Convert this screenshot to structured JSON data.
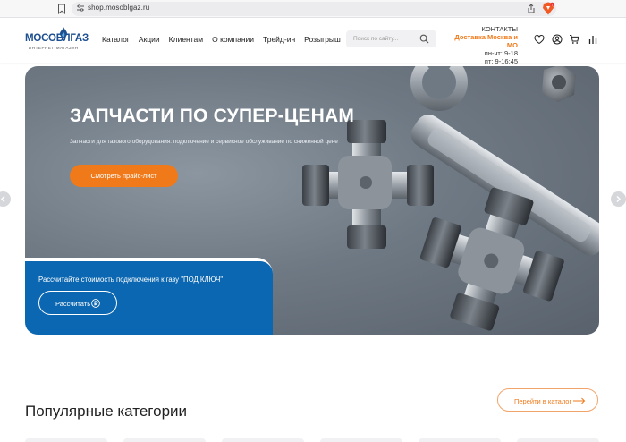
{
  "browser": {
    "url": "shop.mosoblgaz.ru",
    "icons": [
      "bookmark-icon",
      "tune-icon",
      "share-icon",
      "brave-shield-icon"
    ]
  },
  "header": {
    "logo": {
      "name": "МОСОБЛГАЗ",
      "subtitle": "ИНТЕРНЕТ-МАГАЗИН",
      "brand_color": "#1d4f91"
    },
    "nav": [
      "Каталог",
      "Акции",
      "Клиентам",
      "О компании",
      "Трейд-ин",
      "Розыгрыш"
    ],
    "search": {
      "placeholder": "Поиск по сайту..."
    },
    "contacts": {
      "title": "КОНТАКТЫ",
      "delivery": "Доставка Москва и МО",
      "hours_weekdays": "пн-чт: 9-18",
      "hours_friday": "пт: 9-16:45"
    },
    "icons": [
      "heart-icon",
      "user-icon",
      "cart-icon",
      "compare-icon"
    ]
  },
  "hero": {
    "title": "ЗАПЧАСТИ ПО СУПЕР-ЦЕНАМ",
    "subtitle": "Запчасти для газового оборудования: подключение и сервисное обслуживание по сниженной цене",
    "cta": "Смотреть прайс-лист",
    "accent": "#f07a1a",
    "calc": {
      "text": "Рассчитайте стоимость подключения к газу \"ПОД КЛЮЧ\"",
      "button": "Рассчитать",
      "color": "#0b67b1"
    }
  },
  "popular": {
    "title": "Популярные категории",
    "catalog_button": "Перейти в каталог"
  }
}
